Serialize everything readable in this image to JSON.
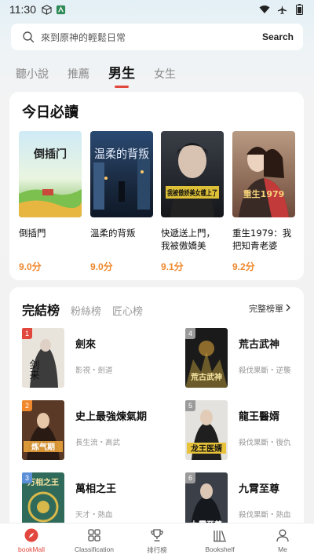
{
  "status_bar": {
    "time": "11:30"
  },
  "search": {
    "placeholder": "來到原神的輕鬆日常",
    "button_label": "Search"
  },
  "top_tabs": [
    {
      "label": "聽小說"
    },
    {
      "label": "推薦"
    },
    {
      "label": "男生",
      "active": true
    },
    {
      "label": "女生"
    }
  ],
  "today": {
    "title": "今日必讀",
    "books": [
      {
        "title": "倒插門",
        "score": "9.0分",
        "cover_text": "倒插门"
      },
      {
        "title": "溫柔的背叛",
        "score": "9.0分",
        "cover_text": "温柔的背叛"
      },
      {
        "title": "快遞送上門，我被傲嬌美女…",
        "score": "9.1分",
        "cover_text": "我被傲娇美女缠上了"
      },
      {
        "title": "重生1979：我把知青老婆寵…",
        "score": "9.2分",
        "cover_text": "重生1979"
      }
    ]
  },
  "ranking": {
    "tabs": [
      {
        "label": "完結榜",
        "active": true
      },
      {
        "label": "粉絲榜"
      },
      {
        "label": "匠心榜"
      }
    ],
    "full_list_label": "完整榜單",
    "items": [
      {
        "rank": "1",
        "name": "劍來",
        "tags": "影視・劍道",
        "cover_text": "剑来",
        "badge_color": "#e2473d"
      },
      {
        "rank": "4",
        "name": "荒古武神",
        "tags": "殺伐果斷・逆襲",
        "cover_text": "荒古武神",
        "badge_color": "#9a9a9a"
      },
      {
        "rank": "2",
        "name": "史上最強煉氣期",
        "tags": "長生流・高武",
        "cover_text": "炼气期",
        "badge_color": "#f0882d"
      },
      {
        "rank": "5",
        "name": "龍王醫婿",
        "tags": "殺伐果斷・復仇",
        "cover_text": "龙王医婿",
        "badge_color": "#9a9a9a"
      },
      {
        "rank": "3",
        "name": "萬相之王",
        "tags": "天才・熱血",
        "cover_text": "万相之王",
        "badge_color": "#5b8fd8"
      },
      {
        "rank": "6",
        "name": "九霄至尊",
        "tags": "殺伐果斷・熱血",
        "cover_text": "九霄至尊",
        "badge_color": "#9a9a9a"
      }
    ]
  },
  "bottom_nav": [
    {
      "label": "bookMall",
      "active": true
    },
    {
      "label": "Classification"
    },
    {
      "label": "排行榜"
    },
    {
      "label": "Bookshelf"
    },
    {
      "label": "Me"
    }
  ],
  "colors": {
    "accent": "#e2473d",
    "score": "#f0882d"
  }
}
